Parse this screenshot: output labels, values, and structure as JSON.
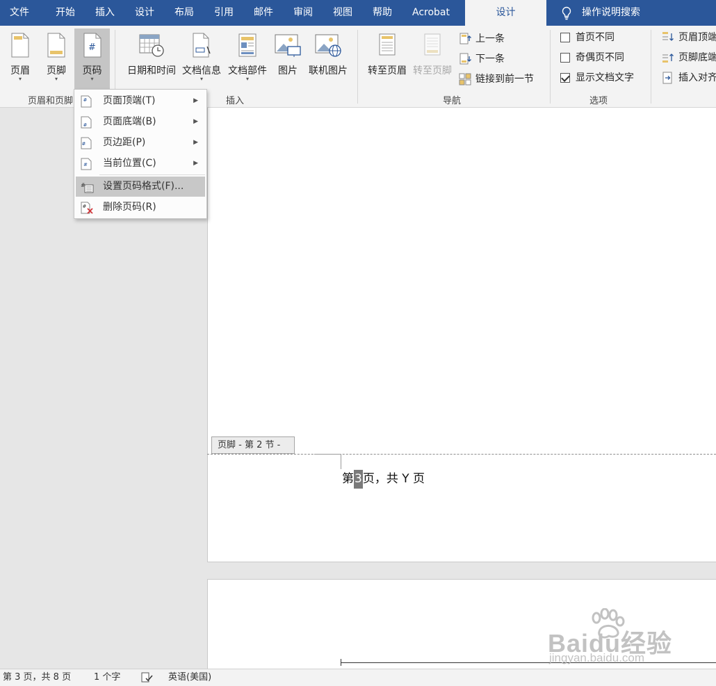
{
  "tabs": [
    "文件",
    "开始",
    "插入",
    "设计",
    "布局",
    "引用",
    "邮件",
    "审阅",
    "视图",
    "帮助",
    "Acrobat"
  ],
  "active_tab": "设计",
  "tell_me": "操作说明搜索",
  "ribbon": {
    "groups": {
      "header_footer": "页眉和页脚",
      "insert": "插入",
      "navigation": "导航",
      "options": "选项"
    },
    "header_btn": "页眉",
    "footer_btn": "页脚",
    "pagenum_btn": "页码",
    "datetime_btn": "日期和时间",
    "docinfo_btn": "文档信息",
    "quickparts_btn": "文档部件",
    "picture_btn": "图片",
    "online_picture_btn": "联机图片",
    "goto_header_btn": "转至页眉",
    "goto_footer_btn": "转至页脚",
    "prev_btn": "上一条",
    "next_btn": "下一条",
    "link_prev_btn": "链接到前一节",
    "opt_first_page": "首页不同",
    "opt_odd_even": "奇偶页不同",
    "opt_show_text": "显示文档文字",
    "pos_header_top": "页眉顶端",
    "pos_footer_bottom": "页脚底端",
    "insert_align_tab": "插入对齐"
  },
  "options_checked": {
    "first_page": false,
    "odd_even": false,
    "show_text": true
  },
  "dropdown": {
    "top_of_page": "页面顶端(T)",
    "bottom_of_page": "页面底端(B)",
    "page_margins": "页边距(P)",
    "current_position": "当前位置(C)",
    "format_page_numbers": "设置页码格式(F)...",
    "remove_page_numbers": "删除页码(R)"
  },
  "document": {
    "footer_tag": "页脚 - 第 2 节 -",
    "footer_text_pre": "第",
    "footer_text_num": "3",
    "footer_text_post": "页，共 Y 页"
  },
  "watermark": {
    "main": "Baidu经验",
    "sub": "jingyan.baidu.com"
  },
  "status": {
    "page": "第 3 页，共 8 页",
    "words": "1 个字",
    "language": "英语(美国)"
  },
  "colors": {
    "title_blue": "#2b579a",
    "ribbon_bg": "#f3f3f3",
    "highlight": "#c8c8c8"
  }
}
